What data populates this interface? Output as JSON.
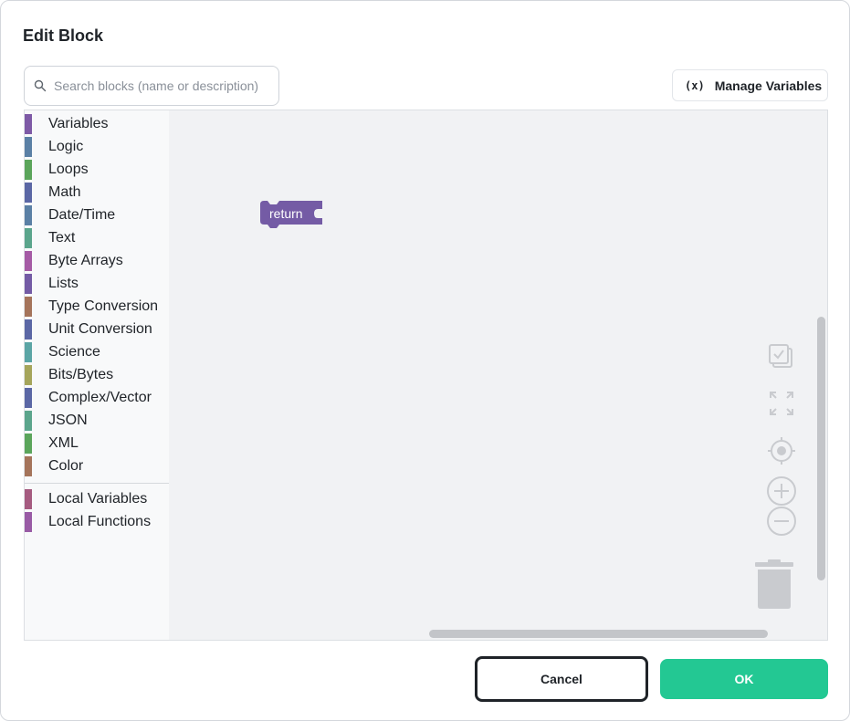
{
  "dialog": {
    "title": "Edit Block"
  },
  "search": {
    "placeholder": "Search blocks (name or description)",
    "value": ""
  },
  "manage_variables": {
    "icon": "(x)",
    "label": "Manage Variables"
  },
  "toolbox": {
    "categories": [
      {
        "label": "Variables",
        "color": "#7e5aa6"
      },
      {
        "label": "Logic",
        "color": "#5b80a5"
      },
      {
        "label": "Loops",
        "color": "#5ba55b"
      },
      {
        "label": "Math",
        "color": "#5b67a5"
      },
      {
        "label": "Date/Time",
        "color": "#5b80a5"
      },
      {
        "label": "Text",
        "color": "#5ba58c"
      },
      {
        "label": "Byte Arrays",
        "color": "#a55ba5"
      },
      {
        "label": "Lists",
        "color": "#745ba5"
      },
      {
        "label": "Type Conversion",
        "color": "#a5745b"
      },
      {
        "label": "Unit Conversion",
        "color": "#5b67a5"
      },
      {
        "label": "Science",
        "color": "#5ba5a5"
      },
      {
        "label": "Bits/Bytes",
        "color": "#a5a55b"
      },
      {
        "label": "Complex/Vector",
        "color": "#5b67a5"
      },
      {
        "label": "JSON",
        "color": "#5ba58c"
      },
      {
        "label": "XML",
        "color": "#5ba55b"
      },
      {
        "label": "Color",
        "color": "#a5745b"
      }
    ],
    "local_categories": [
      {
        "label": "Local Variables",
        "color": "#a55b80"
      },
      {
        "label": "Local Functions",
        "color": "#995ba5"
      }
    ]
  },
  "workspace": {
    "block": {
      "label": "return",
      "color": "#745ba5"
    },
    "controls": [
      "select-all-icon",
      "fit-view-icon",
      "recenter-icon",
      "zoom-in-icon",
      "zoom-out-icon",
      "trash-icon"
    ]
  },
  "footer": {
    "cancel_label": "Cancel",
    "ok_label": "OK",
    "ok_color": "#23c893"
  }
}
